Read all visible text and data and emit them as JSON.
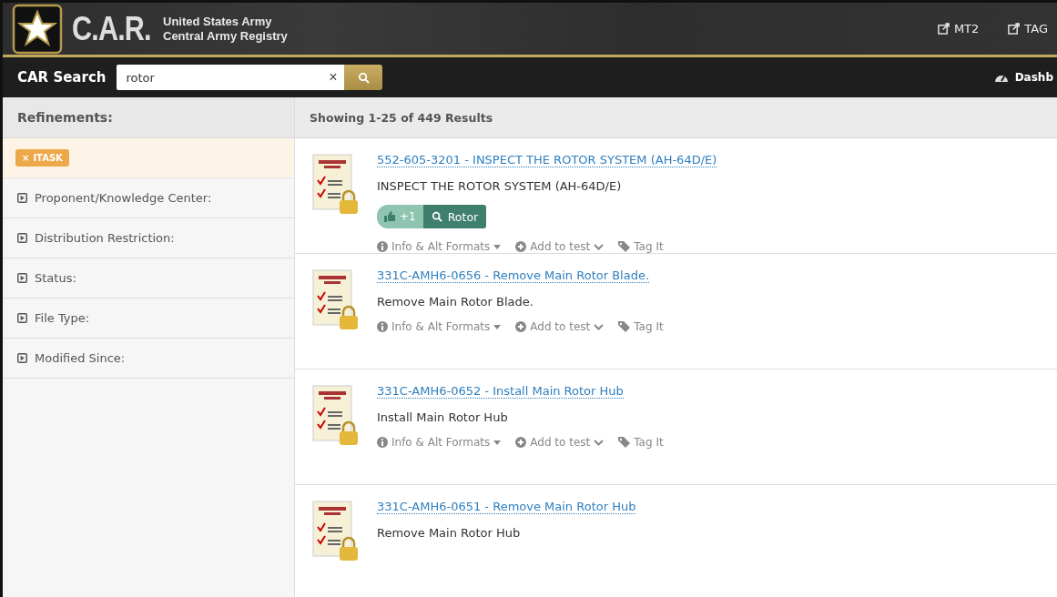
{
  "header": {
    "logo_text": "C.A.R.",
    "subtitle": [
      "United States Army",
      "Central Army Registry"
    ],
    "links": [
      "MT2",
      "TAG"
    ]
  },
  "search_bar": {
    "label": "CAR Search",
    "value": "rotor",
    "clear": "×",
    "nav_link": "Dashb"
  },
  "sidebar": {
    "title": "Refinements:",
    "active_filters": [
      {
        "label": "ITASK",
        "remove": "×"
      }
    ],
    "items": [
      {
        "label": "Proponent/Knowledge Center:",
        "expanded": false
      },
      {
        "label": "Distribution Restriction:",
        "expanded": false
      },
      {
        "label": "Status:",
        "expanded": false
      },
      {
        "label": "File Type:",
        "expanded": false
      },
      {
        "label": "Modified Since:",
        "expanded": false
      }
    ]
  },
  "results": {
    "summary": "Showing 1-25 of 449 Results",
    "items": [
      {
        "title": "552-605-3201 - INSPECT THE ROTOR SYSTEM (AH-64D/E)",
        "description": "INSPECT THE ROTOR SYSTEM (AH-64D/E)",
        "likes": "+1",
        "tag": "Rotor",
        "actions": [
          "Info & Alt Formats",
          "Add to test",
          "Tag It"
        ]
      },
      {
        "title": "331C-AMH6-0656 - Remove Main Rotor Blade.",
        "description": "Remove Main Rotor Blade.",
        "actions": [
          "Info & Alt Formats",
          "Add to test",
          "Tag It"
        ]
      },
      {
        "title": "331C-AMH6-0652 - Install Main Rotor Hub",
        "description": "Install Main Rotor Hub",
        "actions": [
          "Info & Alt Formats",
          "Add to test",
          "Tag It"
        ]
      },
      {
        "title": "331C-AMH6-0651 - Remove Main Rotor Hub",
        "description": "Remove Main Rotor Hub"
      }
    ]
  }
}
